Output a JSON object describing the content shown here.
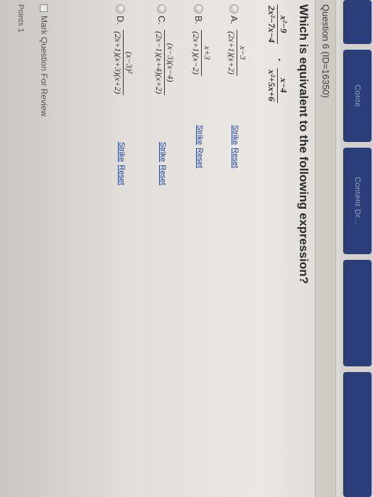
{
  "nav": {
    "buttons": [
      "Conte",
      "Content Dr...",
      "",
      "",
      ""
    ]
  },
  "question": {
    "number_label": "Question 6 (ID=16350)",
    "prompt": "Which is equivalent to the following expression?",
    "expression": {
      "f1_num": "x²−9",
      "f1_den": "2x²−7x−4",
      "operator": "·",
      "f2_num": "x−4",
      "f2_den": "x²+5x+6"
    }
  },
  "choices": [
    {
      "label": "A.",
      "num": "x−3",
      "den": "(2x+1)(x+2)",
      "strike": "Strike",
      "reset": "Reset"
    },
    {
      "label": "B.",
      "num": "x+3",
      "den": "(2x+1)(x−2)",
      "strike": "Strike",
      "reset": "Reset"
    },
    {
      "label": "C.",
      "num": "(x−3)(x−4)",
      "den": "(2x−1)(x+4)(x+2)",
      "strike": "Strike",
      "reset": "Reset"
    },
    {
      "label": "D.",
      "num": "(x−3)²",
      "den": "(2x+1)(x+3)(x+2)",
      "strike": "Strike",
      "reset": "Reset"
    }
  ],
  "review_label": "Mark Question For Review",
  "points_label": "Points 1"
}
